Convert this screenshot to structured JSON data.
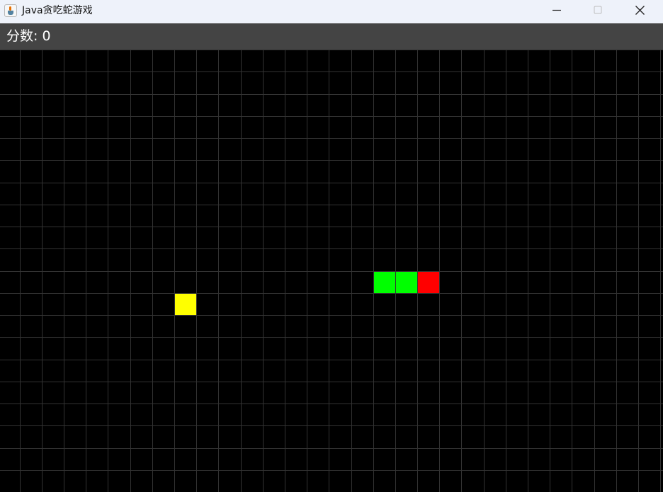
{
  "window": {
    "title": "Java贪吃蛇游戏",
    "app_icon": "java-cup-icon",
    "controls": [
      "minimize-icon",
      "maximize-icon",
      "close-icon"
    ]
  },
  "score": {
    "text": "分数: 0"
  },
  "board": {
    "grid_columns": 30,
    "grid_rows": 20,
    "snake": [
      {
        "col": 19,
        "row": 10,
        "part": "head"
      },
      {
        "col": 18,
        "row": 10,
        "part": "body"
      },
      {
        "col": 17,
        "row": 10,
        "part": "body"
      }
    ],
    "food": {
      "col": 8,
      "row": 11
    },
    "colors": {
      "background": "#000000",
      "grid_line": "#333333",
      "snake_head": "#ff0000",
      "snake_body": "#00ff00",
      "food": "#ffff00",
      "scorebar": "#444444"
    }
  }
}
